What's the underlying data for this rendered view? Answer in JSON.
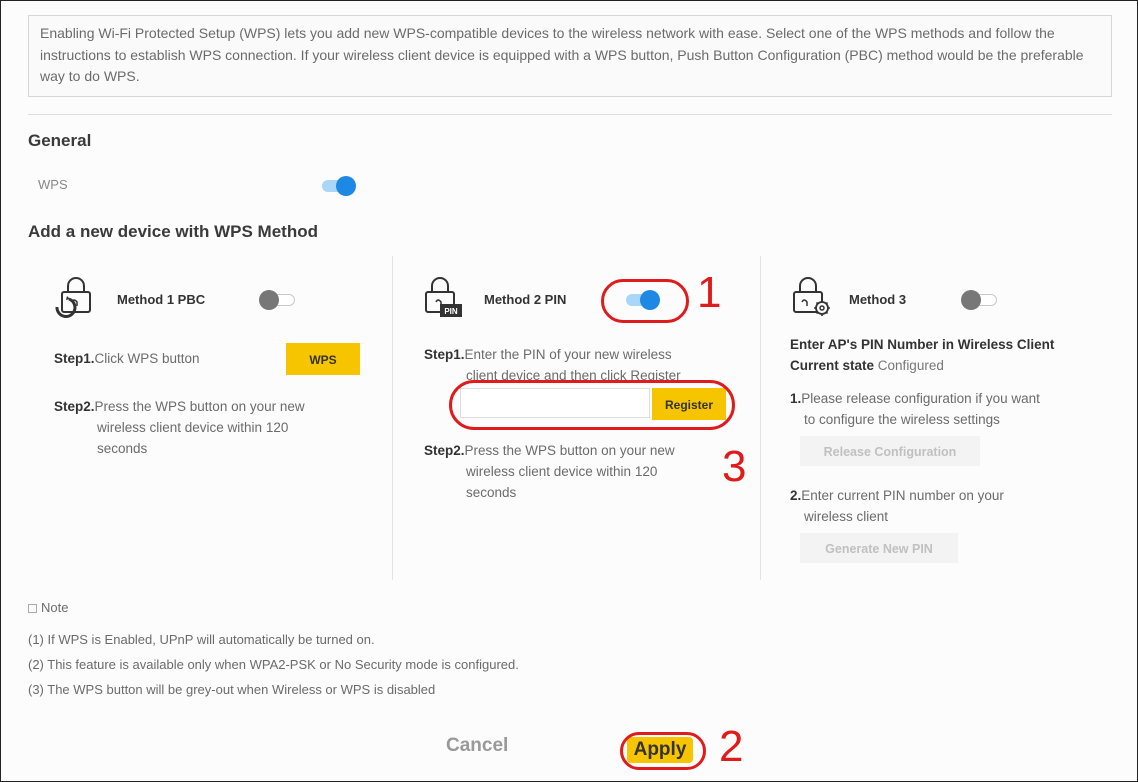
{
  "intro": "Enabling Wi-Fi Protected Setup (WPS) lets you add new WPS-compatible devices to the wireless network with ease. Select one of the WPS methods and follow the instructions to establish WPS connection. If your wireless client device is equipped with a WPS button, Push Button Configuration (PBC) method would be the preferable way to do WPS.",
  "general": {
    "heading": "General",
    "wps_label": "WPS",
    "wps_enabled": true
  },
  "add_heading": "Add a new device with WPS Method",
  "method1": {
    "title": "Method 1 PBC",
    "enabled": false,
    "step1_label": "Step1.",
    "step1_text": "Click WPS button",
    "button": "WPS",
    "step2_label": "Step2.",
    "step2_text": "Press the WPS button on your new",
    "step2_cont1": "wireless client device within 120",
    "step2_cont2": "seconds"
  },
  "method2": {
    "title": "Method 2 PIN",
    "enabled": true,
    "step1_label": "Step1.",
    "step1_text": "Enter the PIN of your new wireless",
    "step1_cont": "client device and then click Register",
    "pin_value": "",
    "button": "Register",
    "step2_label": "Step2.",
    "step2_text": "Press the WPS button on your new",
    "step2_cont1": "wireless client device within 120",
    "step2_cont2": "seconds"
  },
  "method3": {
    "title": "Method 3",
    "enabled": false,
    "heading": "Enter AP's PIN Number in Wireless Client",
    "state_label": "Current state",
    "state_value": "Configured",
    "item1_num": "1.",
    "item1_text": "Please release configuration if you want",
    "item1_cont": "to configure the wireless settings",
    "release_button": "Release Configuration",
    "item2_num": "2.",
    "item2_text": "Enter current PIN number on your",
    "item2_cont": "wireless client",
    "generate_button": "Generate New PIN"
  },
  "note": {
    "title": "Note",
    "lines": [
      "(1) If WPS is Enabled, UPnP will automatically be turned on.",
      "(2) This feature is available only when WPA2-PSK or No Security mode is configured.",
      "(3) The WPS button will be grey-out when Wireless or WPS is disabled"
    ]
  },
  "footer": {
    "cancel": "Cancel",
    "apply": "Apply"
  },
  "callouts": {
    "c1": "1",
    "c2": "2",
    "c3": "3"
  },
  "colors": {
    "accent": "#f7c400",
    "toggle_on": "#1e88e5",
    "callout": "#e01b1b"
  }
}
